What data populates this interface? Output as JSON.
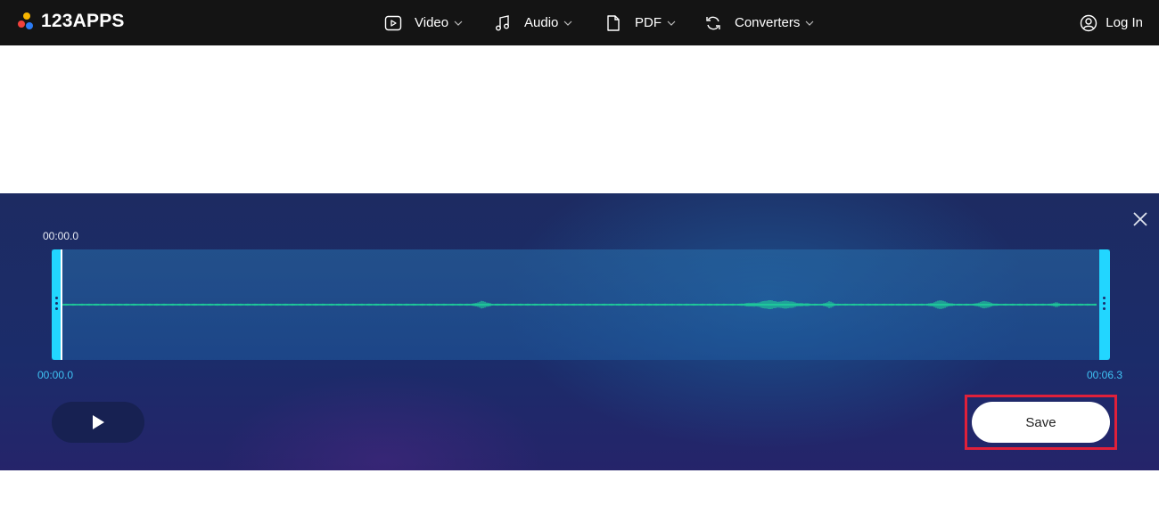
{
  "header": {
    "logo_text": "123APPS",
    "nav": [
      {
        "label": "Video",
        "icon": "video-icon"
      },
      {
        "label": "Audio",
        "icon": "music-note-icon"
      },
      {
        "label": "PDF",
        "icon": "document-icon"
      },
      {
        "label": "Converters",
        "icon": "convert-icon"
      }
    ],
    "login_label": "Log In"
  },
  "editor": {
    "time_top": "00:00.0",
    "time_start": "00:00.0",
    "time_end": "00:06.3",
    "save_label": "Save"
  },
  "colors": {
    "header_bg": "#141414",
    "accent_cyan": "#22d6ff",
    "waveform_green": "#1fd39a",
    "highlight_red": "#e0203a",
    "logo_dot_yellow": "#f7b500",
    "logo_dot_red": "#f0413c",
    "logo_dot_blue": "#2b7cf6"
  }
}
